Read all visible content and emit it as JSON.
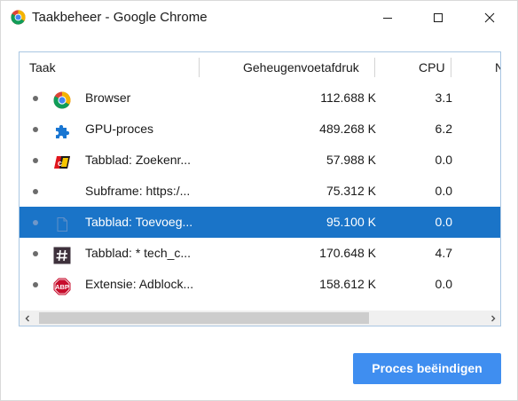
{
  "window": {
    "title": "Taakbeheer - Google Chrome",
    "title_icon": "chrome-logo-icon"
  },
  "table": {
    "headers": {
      "task": "Taak",
      "memory": "Geheugenvoetafdruk",
      "cpu": "CPU",
      "overflow": "N"
    },
    "rows": [
      {
        "icon": "chrome-logo-icon",
        "name": "Browser",
        "memory": "112.688 K",
        "cpu": "3.1",
        "selected": false
      },
      {
        "icon": "puzzle-piece-icon",
        "name": "GPU-proces",
        "memory": "489.268 K",
        "cpu": "6.2",
        "selected": false
      },
      {
        "icon": "site-favicon-icon",
        "name": "Tabblad: Zoekenr...",
        "memory": "57.988 K",
        "cpu": "0.0",
        "selected": false
      },
      {
        "icon": "",
        "name": "Subframe: https:/...",
        "memory": "75.312 K",
        "cpu": "0.0",
        "selected": false
      },
      {
        "icon": "blank-page-icon",
        "name": "Tabblad: Toevoeg...",
        "memory": "95.100 K",
        "cpu": "0.0",
        "selected": true
      },
      {
        "icon": "hashtag-icon",
        "name": "Tabblad: * tech_c...",
        "memory": "170.648 K",
        "cpu": "4.7",
        "selected": false
      },
      {
        "icon": "adblock-abp-icon",
        "name": "Extensie: Adblock...",
        "memory": "158.612 K",
        "cpu": "0.0",
        "selected": false
      }
    ]
  },
  "actions": {
    "end_process_label": "Proces beëindigen"
  },
  "colors": {
    "selection": "#1a74c8",
    "button": "#3f8ef0"
  }
}
